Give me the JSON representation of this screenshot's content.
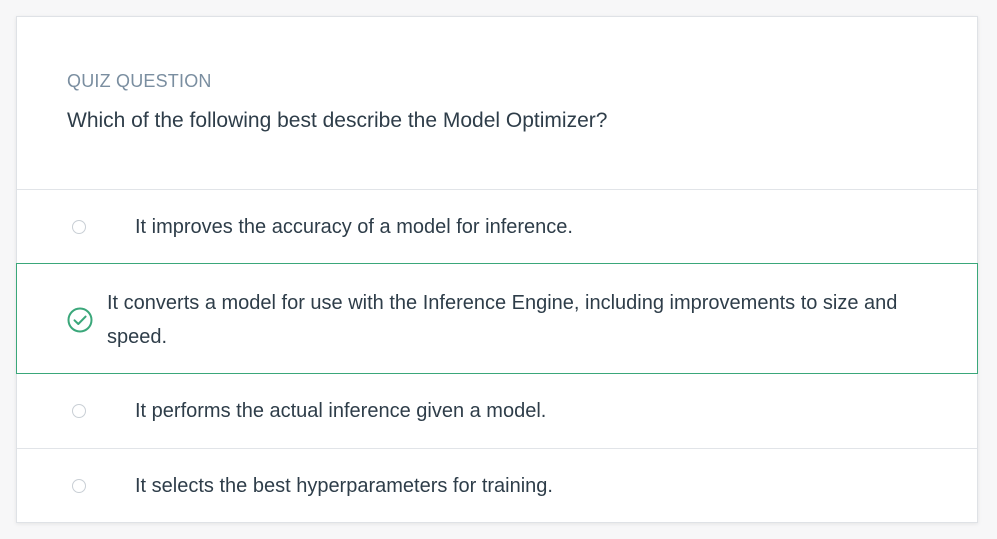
{
  "quiz": {
    "eyebrow": "QUIZ QUESTION",
    "question": "Which of the following best describe the Model Optimizer?",
    "options": [
      {
        "label": "It improves the accuracy of a model for inference.",
        "selected": false
      },
      {
        "label": "It converts a model for use with the Inference Engine, including improvements to size and speed.",
        "selected": true
      },
      {
        "label": "It performs the actual inference given a model.",
        "selected": false
      },
      {
        "label": "It selects the best hyperparameters for training.",
        "selected": false
      }
    ]
  },
  "colors": {
    "correct": "#3aa77a",
    "eyebrow": "#7a8ea0",
    "text": "#2e3d49",
    "divider": "#e1e4e8"
  },
  "icons": {
    "selected": "check-circle-icon",
    "unselected": "radio-empty-icon"
  }
}
